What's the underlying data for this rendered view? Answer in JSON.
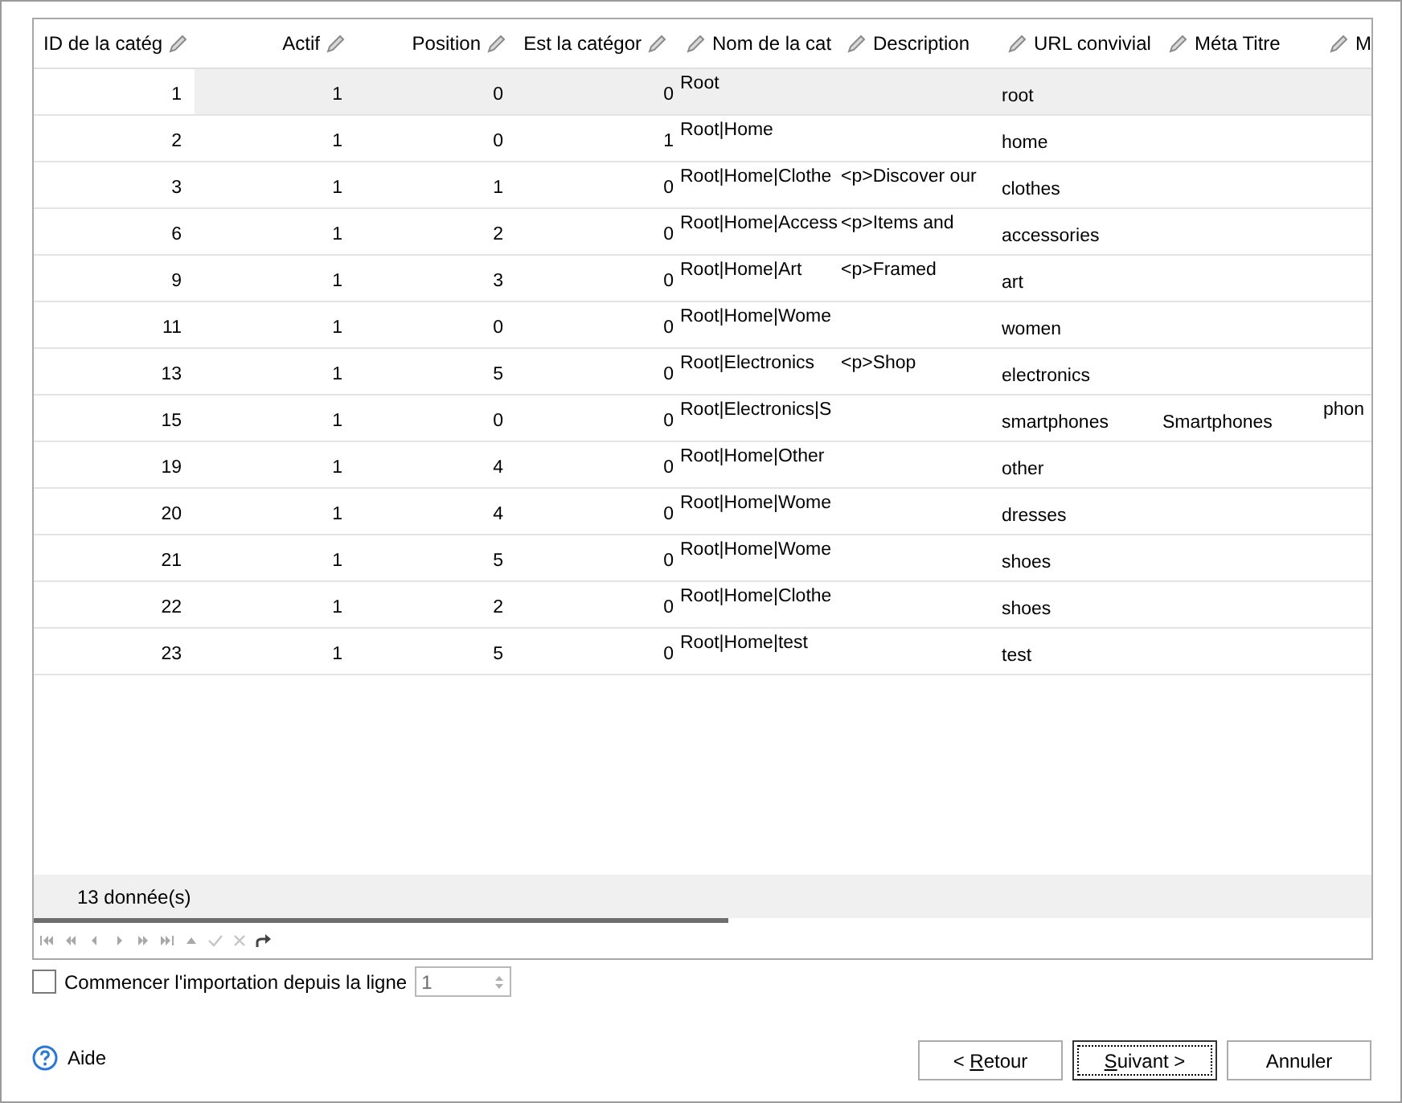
{
  "grid": {
    "columns": [
      {
        "label": "ID de la catég",
        "kind": "numeric"
      },
      {
        "label": "Actif",
        "kind": "numeric"
      },
      {
        "label": "Position",
        "kind": "numeric"
      },
      {
        "label": "Est la catégor",
        "kind": "numeric"
      },
      {
        "label": "Nom de la cat",
        "kind": "label"
      },
      {
        "label": "Description",
        "kind": "label"
      },
      {
        "label": "URL convivial",
        "kind": "slug"
      },
      {
        "label": "Méta Titre",
        "kind": "slug"
      },
      {
        "label": "M",
        "kind": "label"
      }
    ],
    "rows": [
      {
        "selected": true,
        "cells": [
          {
            "text": "1"
          },
          {
            "text": "1"
          },
          {
            "text": "0"
          },
          {
            "text": "0"
          },
          {
            "text": "Root"
          },
          {},
          {
            "text": "root"
          },
          {},
          {}
        ]
      },
      {
        "selected": false,
        "cells": [
          {
            "text": "2"
          },
          {
            "text": "1"
          },
          {
            "text": "0"
          },
          {
            "text": "1"
          },
          {
            "text": "Root|Home"
          },
          {},
          {
            "text": "home"
          },
          {},
          {}
        ]
      },
      {
        "selected": false,
        "cells": [
          {
            "text": "3"
          },
          {
            "text": "1"
          },
          {
            "text": "1"
          },
          {
            "text": "0"
          },
          {
            "text": "Root|Home|Clothe"
          },
          {
            "text": "<p>Discover our"
          },
          {
            "text": "clothes"
          },
          {},
          {}
        ]
      },
      {
        "selected": false,
        "cells": [
          {
            "text": "6"
          },
          {
            "text": "1"
          },
          {
            "text": "2"
          },
          {
            "text": "0"
          },
          {
            "text": "Root|Home|Access"
          },
          {
            "text": "<p>Items and"
          },
          {
            "text": "accessories"
          },
          {},
          {}
        ]
      },
      {
        "selected": false,
        "cells": [
          {
            "text": "9"
          },
          {
            "text": "1"
          },
          {
            "text": "3"
          },
          {
            "text": "0"
          },
          {
            "text": "Root|Home|Art"
          },
          {
            "text": "<p>Framed"
          },
          {
            "text": "art"
          },
          {},
          {}
        ]
      },
      {
        "selected": false,
        "cells": [
          {
            "text": "11"
          },
          {
            "text": "1"
          },
          {
            "text": "0"
          },
          {
            "text": "0"
          },
          {
            "text": "Root|Home|Wome"
          },
          {},
          {
            "text": "women"
          },
          {},
          {}
        ]
      },
      {
        "selected": false,
        "cells": [
          {
            "text": "13"
          },
          {
            "text": "1"
          },
          {
            "text": "5"
          },
          {
            "text": "0"
          },
          {
            "text": "Root|Electronics"
          },
          {
            "text": "<p>Shop"
          },
          {
            "text": "electronics"
          },
          {},
          {}
        ]
      },
      {
        "selected": false,
        "cells": [
          {
            "text": "15"
          },
          {
            "text": "1"
          },
          {
            "text": "0"
          },
          {
            "text": "0"
          },
          {
            "text": "Root|Electronics|S"
          },
          {},
          {
            "text": "smartphones"
          },
          {
            "text": "Smartphones"
          },
          {
            "text": "phon"
          }
        ]
      },
      {
        "selected": false,
        "cells": [
          {
            "text": "19"
          },
          {
            "text": "1"
          },
          {
            "text": "4"
          },
          {
            "text": "0"
          },
          {
            "text": "Root|Home|Other"
          },
          {},
          {
            "text": "other"
          },
          {},
          {}
        ]
      },
      {
        "selected": false,
        "cells": [
          {
            "text": "20"
          },
          {
            "text": "1"
          },
          {
            "text": "4"
          },
          {
            "text": "0"
          },
          {
            "text": "Root|Home|Wome"
          },
          {},
          {
            "text": "dresses"
          },
          {},
          {}
        ]
      },
      {
        "selected": false,
        "cells": [
          {
            "text": "21"
          },
          {
            "text": "1"
          },
          {
            "text": "5"
          },
          {
            "text": "0"
          },
          {
            "text": "Root|Home|Wome"
          },
          {},
          {
            "text": "shoes"
          },
          {},
          {}
        ]
      },
      {
        "selected": false,
        "cells": [
          {
            "text": "22"
          },
          {
            "text": "1"
          },
          {
            "text": "2"
          },
          {
            "text": "0"
          },
          {
            "text": "Root|Home|Clothe"
          },
          {},
          {
            "text": "shoes"
          },
          {},
          {}
        ]
      },
      {
        "selected": false,
        "cells": [
          {
            "text": "23"
          },
          {
            "text": "1"
          },
          {
            "text": "5"
          },
          {
            "text": "0"
          },
          {
            "text": "Root|Home|test"
          },
          {},
          {
            "text": "test"
          },
          {},
          {}
        ]
      }
    ],
    "footer": "13 donnée(s)"
  },
  "start_row": {
    "checked": false,
    "label": "Commencer l'importation depuis la ligne",
    "value": "1",
    "disabled": true
  },
  "help": {
    "label": "Aide"
  },
  "buttons": [
    {
      "label_parts": [
        {
          "text": "< ",
          "underlined": false
        },
        {
          "text": "R",
          "underlined": true
        },
        {
          "text": "etour",
          "underlined": false
        }
      ],
      "default": false
    },
    {
      "label_parts": [
        {
          "text": "S",
          "underlined": true
        },
        {
          "text": "uivant >",
          "underlined": false
        }
      ],
      "default": true
    },
    {
      "label_parts": [
        {
          "text": "Annuler",
          "underlined": false
        }
      ],
      "default": false
    }
  ]
}
